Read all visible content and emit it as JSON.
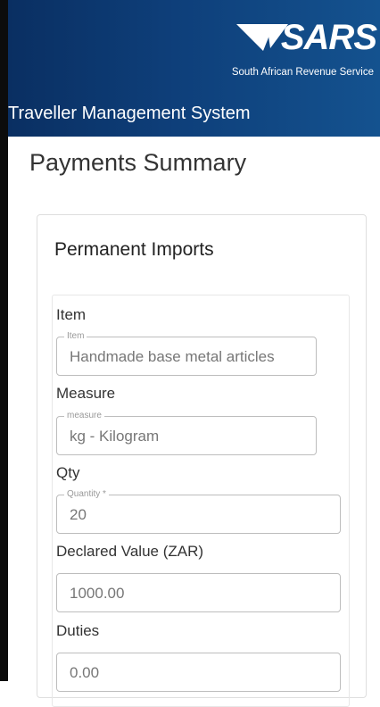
{
  "header": {
    "brand": "SARS",
    "brand_subtitle": "South African Revenue Service",
    "system_title": "Traveller Management System",
    "colors": {
      "header_bg": "#0e3f7a",
      "header_text": "#ffffff"
    }
  },
  "page": {
    "title": "Payments Summary"
  },
  "card": {
    "title": "Permanent Imports",
    "fields": {
      "item": {
        "label": "Item",
        "legend": "Item",
        "value": "Handmade base metal articles"
      },
      "measure": {
        "label": "Measure",
        "legend": "measure",
        "value": "kg - Kilogram"
      },
      "qty": {
        "label": "Qty",
        "legend": "Quantity *",
        "value": "20"
      },
      "declared_value": {
        "label": "Declared Value (ZAR)",
        "value": "1000.00"
      },
      "duties": {
        "label": "Duties",
        "value": "0.00"
      }
    }
  }
}
